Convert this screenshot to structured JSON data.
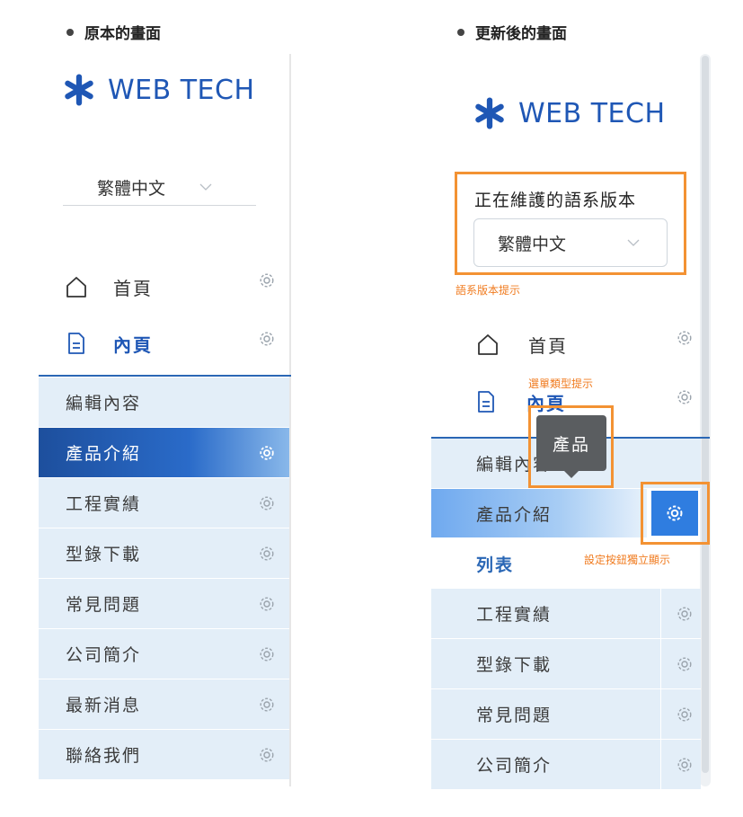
{
  "left": {
    "heading": "原本的畫面",
    "logo_text": "WEB TECH",
    "language": "繁體中文",
    "nav_home": "首頁",
    "nav_inner": "內頁",
    "menu": [
      "編輯內容",
      "產品介紹",
      "工程實績",
      "型錄下載",
      "常見問題",
      "公司簡介",
      "最新消息",
      "聯絡我們"
    ],
    "active_index": 1
  },
  "right": {
    "heading": "更新後的畫面",
    "logo_text": "WEB TECH",
    "lang_label": "正在維護的語系版本",
    "language": "繁體中文",
    "lang_hint": "語系版本提示",
    "nav_home": "首頁",
    "nav_inner": "內頁",
    "type_hint": "選單類型提示",
    "tooltip": "產品",
    "menu_edit": "編輯內容",
    "menu_active": "產品介紹",
    "list_label": "列表",
    "settings_hint": "設定按鈕獨立顯示",
    "menu_rest": [
      "工程實績",
      "型錄下載",
      "常見問題",
      "公司簡介"
    ]
  },
  "colors": {
    "brand": "#1f57b5",
    "highlight": "#f39233",
    "menu_bg": "#e3eef8",
    "active_left": "#1d4f9d",
    "gear_button": "#2f7de0"
  }
}
